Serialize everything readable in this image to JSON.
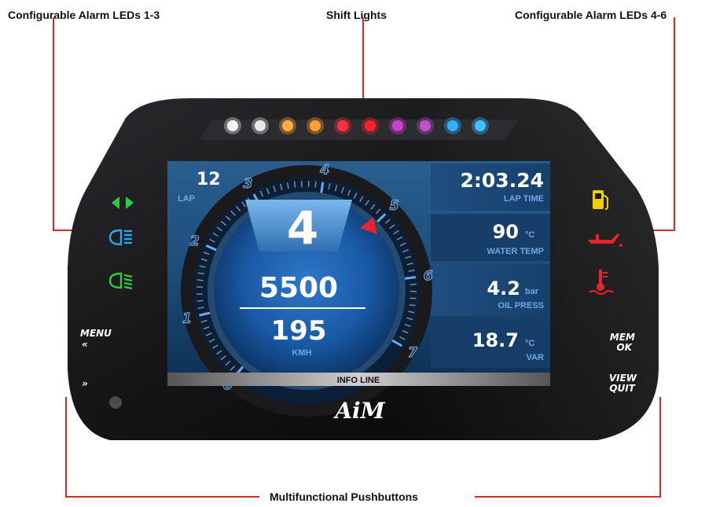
{
  "callouts": {
    "alarm_left": "Configurable Alarm LEDs 1-3",
    "shift_lights": "Shift Lights",
    "alarm_right": "Configurable Alarm LEDs 4-6",
    "pushbuttons": "Multifunctional Pushbuttons"
  },
  "screen": {
    "lap_value": "12",
    "lap_label": "LAP",
    "gear": "4",
    "rpm": "5500",
    "speed": "195",
    "speed_unit": "KMH",
    "lap_time": "2:03.24",
    "lap_time_label": "LAP TIME",
    "water_temp": "90",
    "water_temp_unit": "°C",
    "water_temp_label": "WATER TEMP",
    "oil_press": "4.2",
    "oil_press_unit": "bar",
    "oil_press_label": "OIL PRESS",
    "var_value": "18.7",
    "var_unit": "°C",
    "var_label": "VAR",
    "info_line": "INFO LINE",
    "gauge_ticks": [
      "0",
      "1",
      "2",
      "3",
      "4",
      "5",
      "6",
      "7"
    ]
  },
  "buttons": {
    "menu": "MENU",
    "menu_arrow": "«",
    "next_arrow": "»",
    "mem": "MEM",
    "ok": "OK",
    "view": "VIEW",
    "quit": "QUIT"
  },
  "brand": "AiM",
  "shift_light_colors": [
    "#f4f4f4",
    "#e8e8e8",
    "#ffb040",
    "#ffa030",
    "#ff3040",
    "#ff2030",
    "#cc40cc",
    "#c050d0",
    "#30b0ff",
    "#40c0ff"
  ],
  "alarm_led_icons": [
    "turn-signal-icon",
    "low-beam-icon",
    "high-beam-icon",
    "fuel-icon",
    "oil-pressure-icon",
    "coolant-temp-icon"
  ]
}
